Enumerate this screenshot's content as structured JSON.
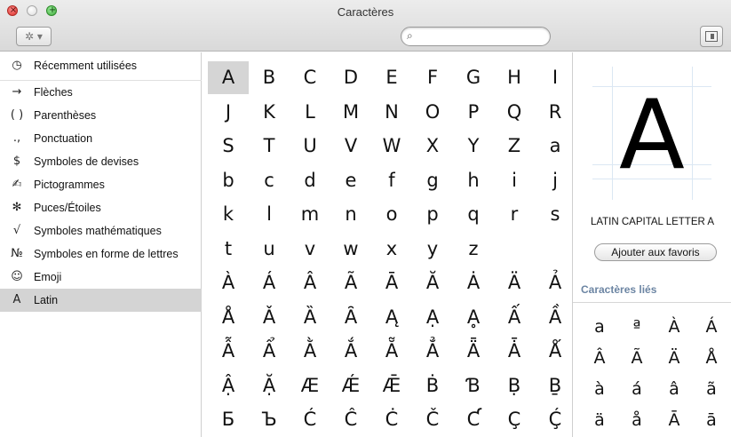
{
  "window": {
    "title": "Caractères",
    "close_glyph": "×",
    "zoom_glyph": "+",
    "gear_label": "✲ ▾",
    "search_icon": "⌕",
    "search_value": "",
    "search_placeholder": ""
  },
  "sidebar": {
    "items": [
      {
        "icon": "◷",
        "icon_name": "clock-icon",
        "label": "Récemment utilisées"
      },
      {
        "icon": "→",
        "icon_name": "arrow-icon",
        "label": "Flèches"
      },
      {
        "icon": "( )",
        "icon_name": "parentheses-icon",
        "label": "Parenthèses"
      },
      {
        "icon": ".,",
        "icon_name": "punctuation-icon",
        "label": "Ponctuation"
      },
      {
        "icon": "$",
        "icon_name": "dollar-icon",
        "label": "Symboles de devises"
      },
      {
        "icon": "✍",
        "icon_name": "pictogram-icon",
        "label": "Pictogrammes"
      },
      {
        "icon": "✻",
        "icon_name": "asterisk-icon",
        "label": "Puces/Étoiles"
      },
      {
        "icon": "√",
        "icon_name": "square-root-icon",
        "label": "Symboles mathématiques"
      },
      {
        "icon": "№",
        "icon_name": "numero-icon",
        "label": "Symboles en forme de lettres"
      },
      {
        "icon": "☺",
        "icon_name": "smiley-icon",
        "label": "Emoji"
      },
      {
        "icon": "A",
        "icon_name": "latin-a-icon",
        "label": "Latin"
      }
    ],
    "selected": "Latin"
  },
  "grid": {
    "rows": [
      [
        "A",
        "B",
        "C",
        "D",
        "E",
        "F",
        "G",
        "H",
        "I"
      ],
      [
        "J",
        "K",
        "L",
        "M",
        "N",
        "O",
        "P",
        "Q",
        "R"
      ],
      [
        "S",
        "T",
        "U",
        "V",
        "W",
        "X",
        "Y",
        "Z",
        "a"
      ],
      [
        "b",
        "c",
        "d",
        "e",
        "f",
        "g",
        "h",
        "i",
        "j"
      ],
      [
        "k",
        "l",
        "m",
        "n",
        "o",
        "p",
        "q",
        "r",
        "s"
      ],
      [
        "t",
        "u",
        "v",
        "w",
        "x",
        "y",
        "z"
      ],
      [
        "À",
        "Á",
        "Â",
        "Ã",
        "Ā",
        "Ă",
        "Ȧ",
        "Ä",
        "Ả"
      ],
      [
        "Å",
        "Ǎ",
        "Ȁ",
        "Ȃ",
        "Ą",
        "Ạ",
        "Ḁ",
        "Ấ",
        "Ầ"
      ],
      [
        "Ẫ",
        "Ẩ",
        "Ằ",
        "Ắ",
        "Ẵ",
        "Ẳ",
        "Ǟ",
        "Ǡ",
        "Ǻ"
      ],
      [
        "Ậ",
        "Ặ",
        "Æ",
        "Ǽ",
        "Ǣ",
        "Ḃ",
        "Ɓ",
        "Ḅ",
        "Ḇ"
      ],
      [
        "Б",
        "Ъ",
        "Ć",
        "Ĉ",
        "Ċ",
        "Č",
        "Ƈ",
        "Ç",
        "Ḉ"
      ]
    ],
    "selected": "A"
  },
  "preview": {
    "glyph": "A",
    "name": "LATIN CAPITAL LETTER A",
    "favorites_button": "Ajouter aux favoris"
  },
  "related": {
    "title": "Caractères liés",
    "chars": [
      "a",
      "ª",
      "À",
      "Á",
      "Â",
      "Ã",
      "Ä",
      "Å",
      "à",
      "á",
      "â",
      "ã",
      "ä",
      "å",
      "Ā",
      "ā"
    ]
  }
}
